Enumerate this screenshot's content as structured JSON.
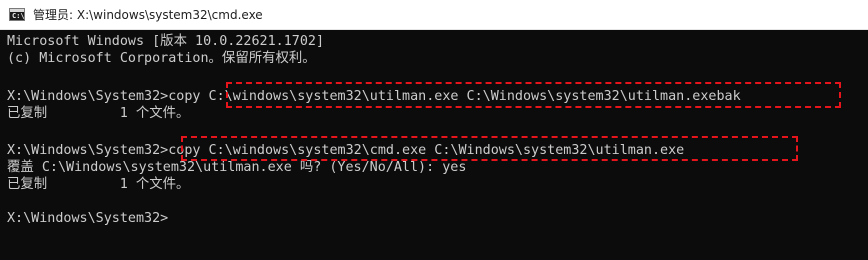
{
  "window": {
    "title": "管理员: X:\\windows\\system32\\cmd.exe",
    "icon": "cmd-icon"
  },
  "console": {
    "lines": [
      "Microsoft Windows [版本 10.0.22621.1702]",
      "(c) Microsoft Corporation。保留所有权利。",
      "",
      "X:\\Windows\\System32>copy C:\\windows\\system32\\utilman.exe C:\\Windows\\system32\\utilman.exebak",
      "已复制         1 个文件。",
      "",
      "X:\\Windows\\System32>copy C:\\windows\\system32\\cmd.exe C:\\Windows\\system32\\utilman.exe",
      "覆盖 C:\\Windows\\system32\\utilman.exe 吗? (Yes/No/All): yes",
      "已复制         1 个文件。",
      "",
      "X:\\Windows\\System32>"
    ]
  },
  "colors": {
    "console_bg": "#0c0c0c",
    "console_fg": "#cccccc",
    "highlight": "#e8141c"
  }
}
